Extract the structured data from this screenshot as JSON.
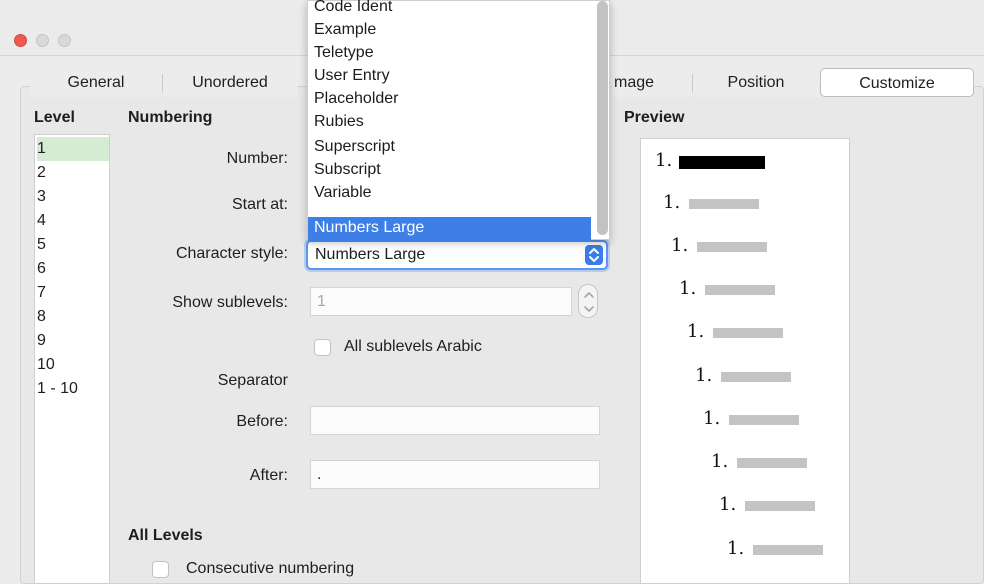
{
  "window": {
    "close_color": "#ee5a52"
  },
  "tabs": [
    {
      "label": "General"
    },
    {
      "label": "Unordered"
    },
    {
      "label": "mage"
    },
    {
      "label": "Position"
    },
    {
      "label": "Customize",
      "active": true
    }
  ],
  "level": {
    "heading": "Level",
    "items": [
      "1",
      "2",
      "3",
      "4",
      "5",
      "6",
      "7",
      "8",
      "9",
      "10",
      "1 - 10"
    ],
    "selected": "1"
  },
  "numbering": {
    "heading": "Numbering",
    "number_label": "Number:",
    "start_at_label": "Start at:",
    "character_style_label": "Character style:",
    "character_style_value": "Numbers Large",
    "show_sublevels_label": "Show sublevels:",
    "show_sublevels_value": "1",
    "all_sublevels_arabic_label": "All sublevels Arabic",
    "separator_heading": "Separator",
    "before_label": "Before:",
    "before_value": "",
    "after_label": "After:",
    "after_value": "."
  },
  "all_levels": {
    "heading": "All Levels",
    "consecutive_numbering_label": "Consecutive numbering"
  },
  "dropdown": {
    "items": [
      "Code Ident",
      "Example",
      "Teletype",
      "User Entry",
      "Placeholder",
      "Rubies",
      "Superscript",
      "Subscript",
      "Variable",
      "Numbers Large"
    ],
    "highlighted": "Numbers Large",
    "highlight_color": "#3d7fe6"
  },
  "preview": {
    "heading": "Preview",
    "rows": [
      "1.",
      "1.",
      "1.",
      "1.",
      "1.",
      "1.",
      "1.",
      "1.",
      "1.",
      "1."
    ]
  }
}
